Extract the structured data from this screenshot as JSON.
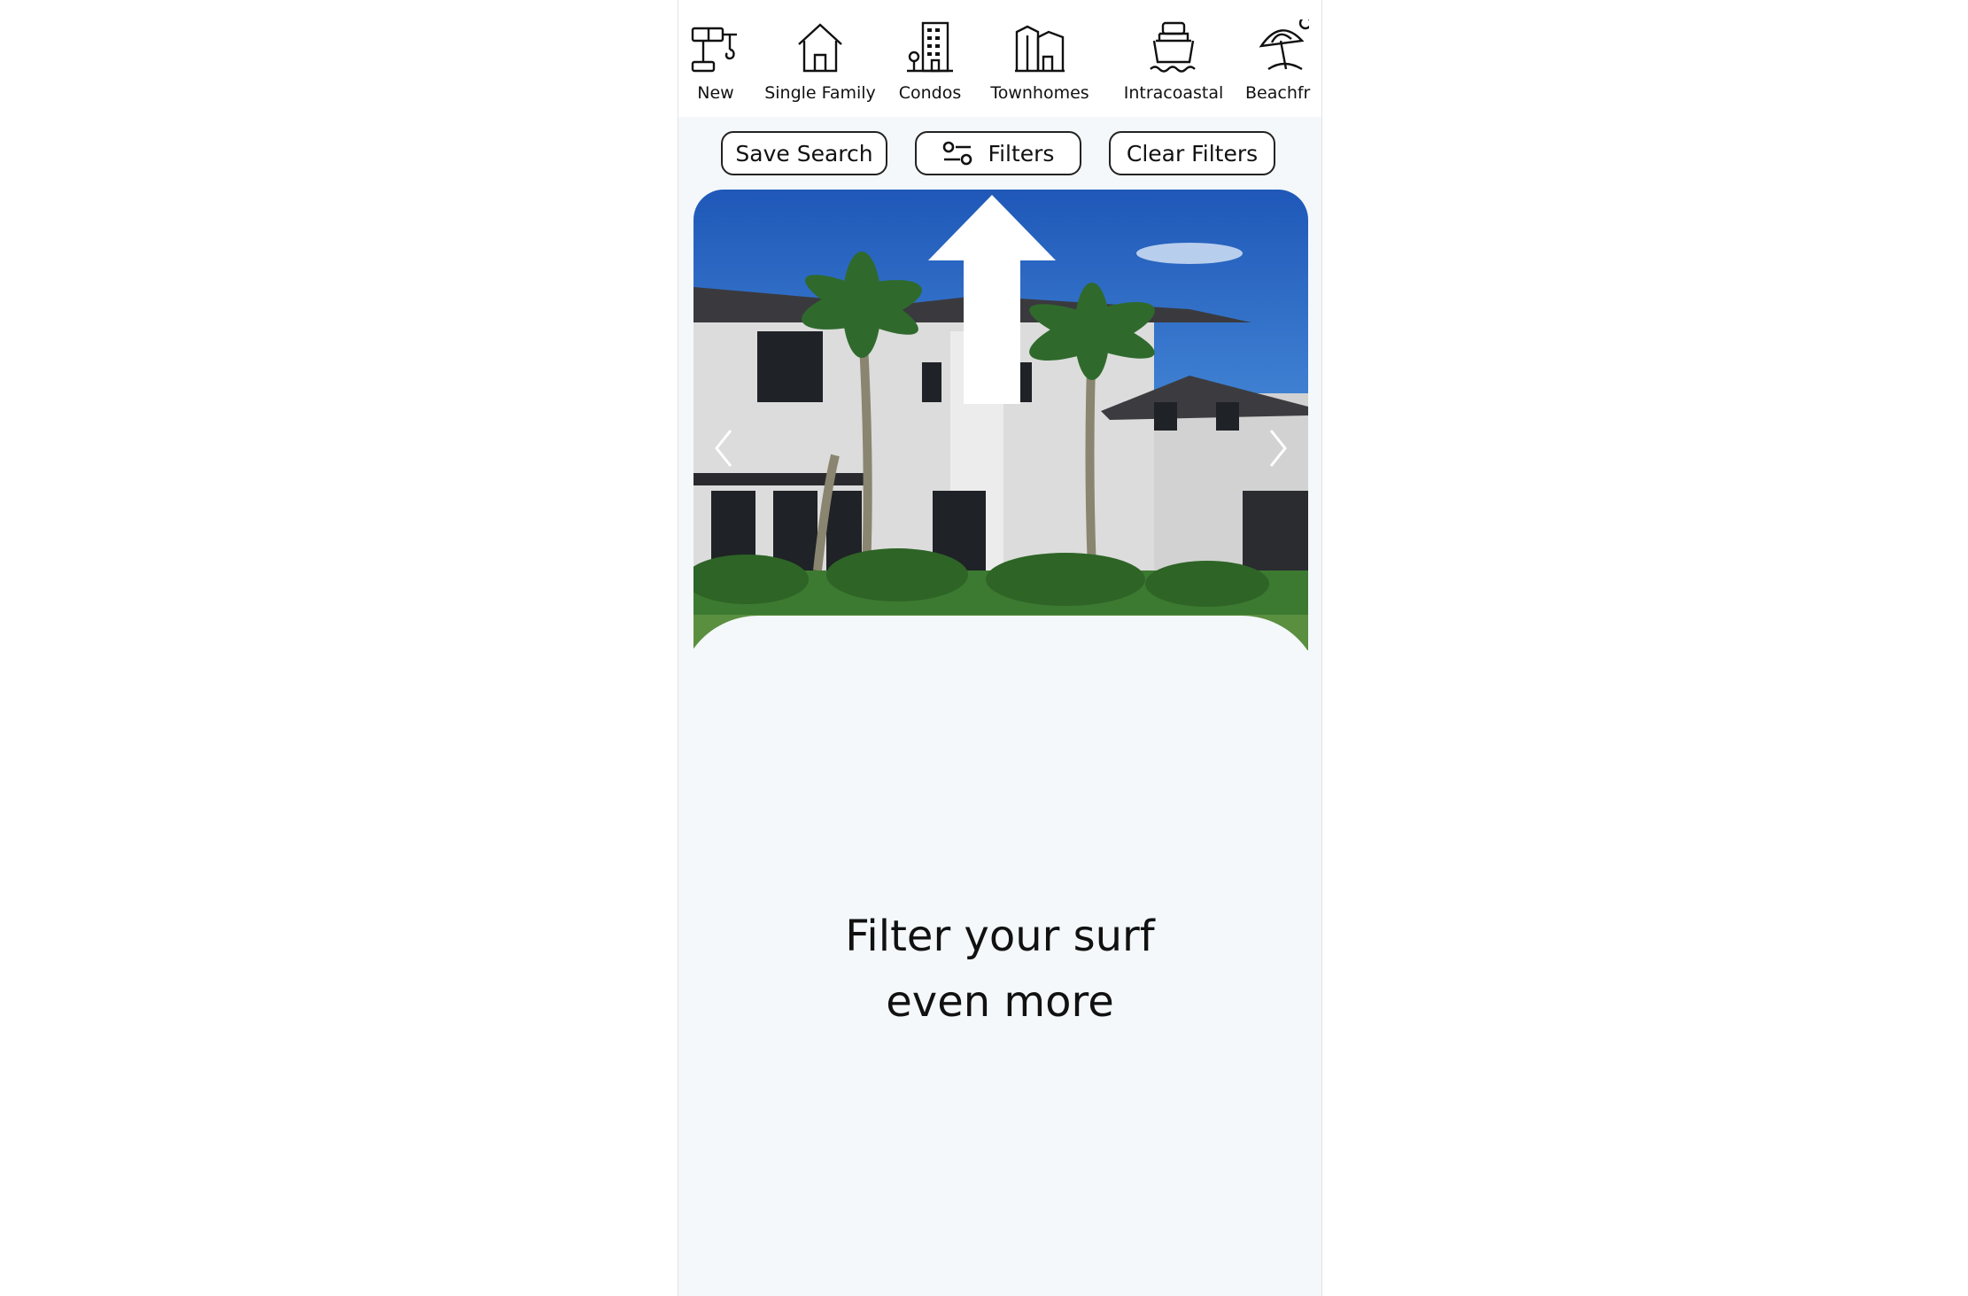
{
  "categories": [
    {
      "label": "New",
      "icon": "crane-icon"
    },
    {
      "label": "Single Family",
      "icon": "house-icon"
    },
    {
      "label": "Condos",
      "icon": "condo-building-icon"
    },
    {
      "label": "Townhomes",
      "icon": "townhomes-icon"
    },
    {
      "label": "Intracoastal",
      "icon": "boat-icon"
    },
    {
      "label": "Beachfr",
      "icon": "beach-umbrella-icon"
    }
  ],
  "buttons": {
    "save_search": "Save Search",
    "filters": "Filters",
    "clear_filters": "Clear Filters"
  },
  "listing": {
    "prev_icon": "chevron-left-icon",
    "next_icon": "chevron-right-icon"
  },
  "tooltip": {
    "line1": "Filter your surf",
    "line2": "even more"
  },
  "colors": {
    "panel_bg": "#f4f8fa",
    "sky": "#2f72c9",
    "border": "#222222"
  }
}
